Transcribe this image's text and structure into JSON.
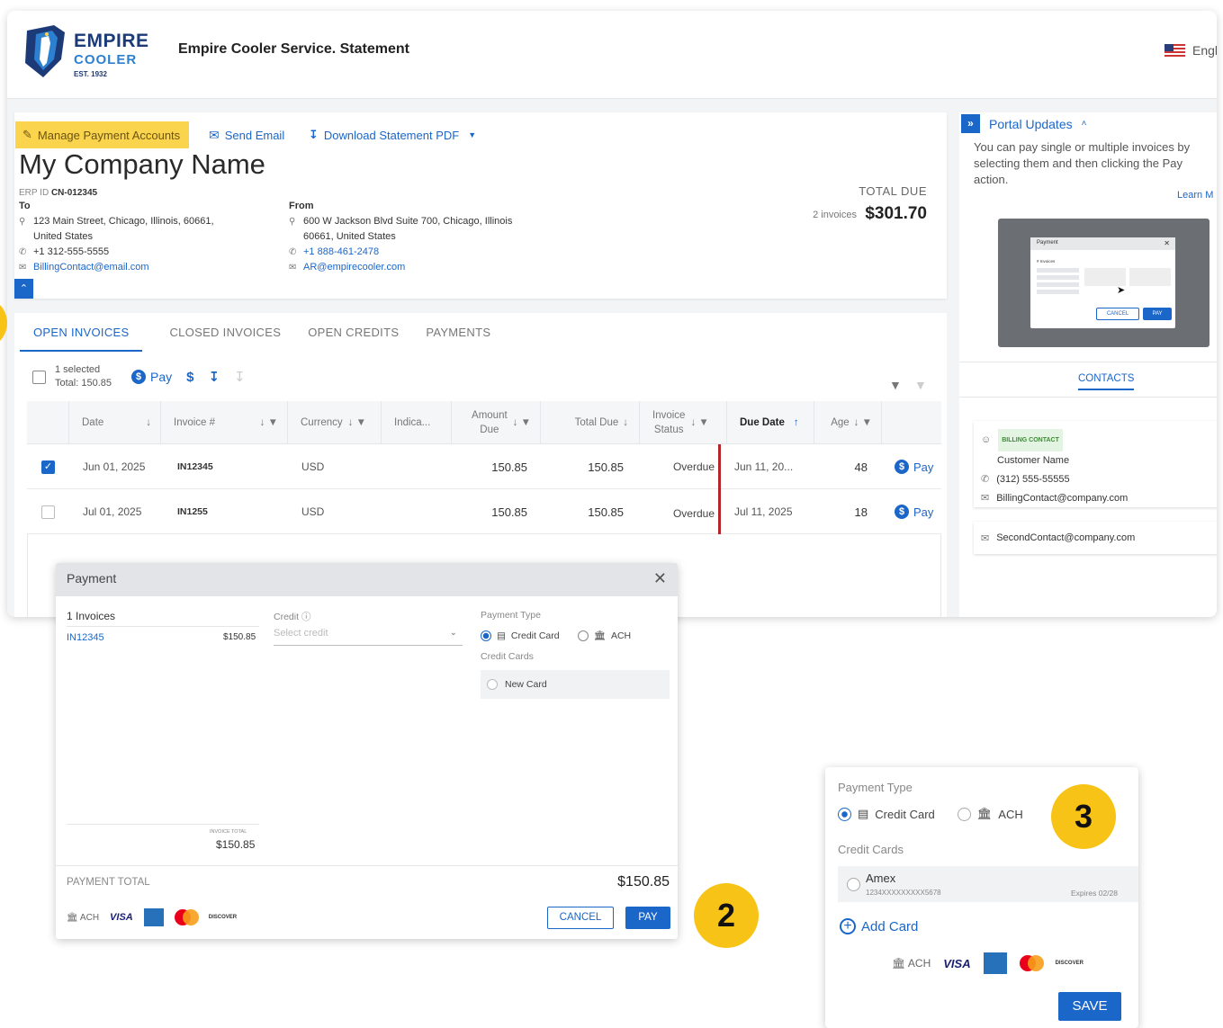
{
  "header": {
    "logo_line1": "EMPIRE",
    "logo_line2": "COOLER",
    "logo_est": "EST. 1932",
    "app_title": "Empire Cooler Service. Statement",
    "language": "Engl"
  },
  "actions": {
    "manage_payment": "Manage Payment Accounts",
    "send_email": "Send Email",
    "download_pdf": "Download Statement PDF"
  },
  "company": {
    "name": "My Company Name",
    "erp_label": "ERP ID",
    "erp_id": "CN-012345"
  },
  "to": {
    "heading": "To",
    "address_line1": "123 Main Street, Chicago, Illinois, 60661,",
    "address_line2": "United States",
    "phone": "+1 312-555-5555",
    "email": "BillingContact@email.com"
  },
  "from": {
    "heading": "From",
    "address_line1": "600 W Jackson Blvd Suite 700, Chicago, Illinois",
    "address_line2": "60661, United States",
    "phone": "+1 888-461-2478",
    "email": "AR@empirecooler.com"
  },
  "totals": {
    "label": "TOTAL DUE",
    "count": "2 invoices",
    "amount": "$301.70"
  },
  "tabs": [
    "OPEN INVOICES",
    "CLOSED INVOICES",
    "OPEN CREDITS",
    "PAYMENTS"
  ],
  "selection": {
    "selected": "1 selected",
    "total": "Total: 150.85",
    "pay_label": "Pay",
    "currency_symbol": "$"
  },
  "table": {
    "columns": {
      "date": "Date",
      "invoice": "Invoice #",
      "currency": "Currency",
      "indicator": "Indica...",
      "amount_due_1": "Amount",
      "amount_due_2": "Due",
      "total_due": "Total Due",
      "status_1": "Invoice",
      "status_2": "Status",
      "due_date": "Due Date",
      "age": "Age"
    },
    "rows": [
      {
        "date": "Jun 01, 2025",
        "invoice": "IN12345",
        "currency": "USD",
        "amount_due": "150.85",
        "total_due": "150.85",
        "status": "Overdue",
        "due_date": "Jun 11, 20...",
        "age": "48",
        "pay": "Pay"
      },
      {
        "date": "Jul 01, 2025",
        "invoice": "IN1255",
        "currency": "USD",
        "amount_due": "150.85",
        "total_due": "150.85",
        "status": "Overdue",
        "due_date": "Jul 11, 2025",
        "age": "18",
        "pay": "Pay"
      }
    ]
  },
  "sidebar": {
    "title": "Portal Updates",
    "text": "You can pay single or multiple invoices by selecting them and then clicking the Pay action.",
    "learn_more": "Learn M",
    "preview": {
      "title": "Payment",
      "invoices": "# Invoices",
      "cancel": "CANCEL",
      "pay": "PAY"
    },
    "contacts_tab": "CONTACTS",
    "contact1": {
      "badge": "BILLING CONTACT",
      "name": "Customer Name",
      "phone": "(312) 555-55555",
      "email": "BillingContact@company.com"
    },
    "contact2": {
      "email": "SecondContact@company.com"
    }
  },
  "payment_modal": {
    "title": "Payment",
    "invoices_count": "1 Invoices",
    "invoice_id": "IN12345",
    "invoice_amount": "$150.85",
    "credit_label": "Credit",
    "credit_placeholder": "Select credit",
    "payment_type_label": "Payment Type",
    "credit_card": "Credit Card",
    "ach": "ACH",
    "credit_cards_label": "Credit Cards",
    "new_card": "New Card",
    "invoice_total_label": "INVOICE TOTAL",
    "invoice_total": "$150.85",
    "payment_total_label": "PAYMENT TOTAL",
    "payment_total": "$150.85",
    "cancel": "CANCEL",
    "pay": "PAY"
  },
  "payment_methods": {
    "ach": "ACH",
    "visa": "VISA",
    "amex": "AMERICAN EXPRESS",
    "mastercard": "mastercard",
    "discover": "DISCOVER"
  },
  "card_modal": {
    "payment_type_label": "Payment Type",
    "credit_card": "Credit Card",
    "ach": "ACH",
    "credit_cards_label": "Credit Cards",
    "card_name": "Amex",
    "card_number": "1234XXXXXXXXX5678",
    "card_expiry": "Expires 02/28",
    "add_card": "Add Card",
    "save": "SAVE"
  },
  "steps": {
    "step2": "2",
    "step3": "3"
  },
  "colors": {
    "accent": "#1b66c9",
    "highlight": "#fbd44d",
    "step": "#f7c317",
    "overdue": "#b3262a"
  }
}
